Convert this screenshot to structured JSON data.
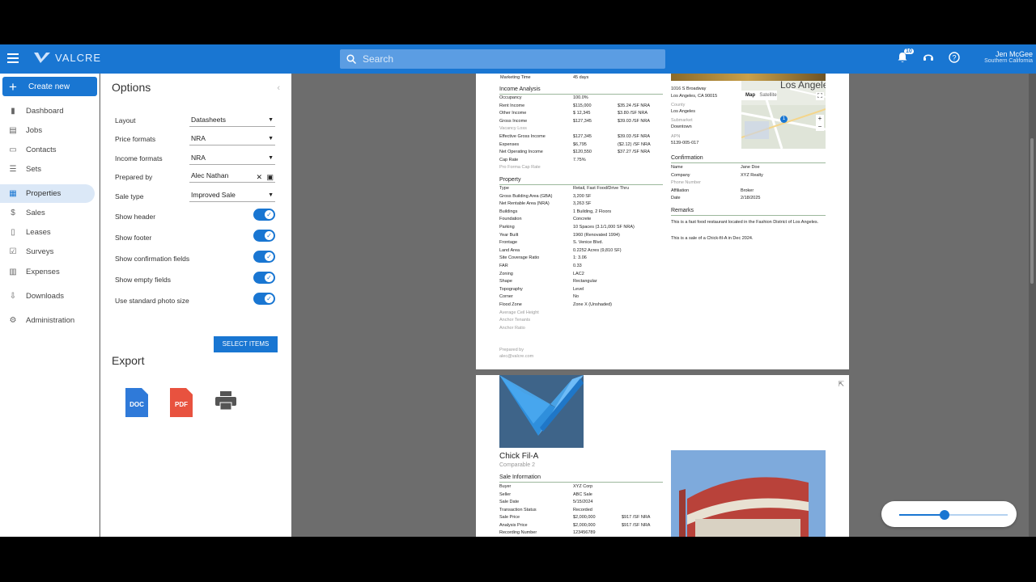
{
  "topbar": {
    "logo_text": "VALCRE",
    "search_placeholder": "Search",
    "notifications_count": "10",
    "user_name": "Jen McGee",
    "user_region": "Southern California"
  },
  "sidebar": {
    "create_label": "Create new",
    "items": [
      {
        "label": "Dashboard",
        "icon": "bar-chart-icon"
      },
      {
        "label": "Jobs",
        "icon": "clipboard-icon"
      },
      {
        "label": "Contacts",
        "icon": "contact-card-icon"
      },
      {
        "label": "Sets",
        "icon": "list-icon"
      },
      {
        "label": "Properties",
        "icon": "building-icon"
      },
      {
        "label": "Sales",
        "icon": "dollar-icon"
      },
      {
        "label": "Leases",
        "icon": "document-icon"
      },
      {
        "label": "Surveys",
        "icon": "checklist-icon"
      },
      {
        "label": "Expenses",
        "icon": "receipt-icon"
      },
      {
        "label": "Downloads",
        "icon": "download-icon"
      },
      {
        "label": "Administration",
        "icon": "gear-icon"
      }
    ]
  },
  "options": {
    "title": "Options",
    "layout_label": "Layout",
    "layout_value": "Datasheets",
    "price_label": "Price formats",
    "price_value": "NRA",
    "income_label": "Income formats",
    "income_value": "NRA",
    "prepared_label": "Prepared by",
    "prepared_value": "Alec Nathan",
    "saletype_label": "Sale type",
    "saletype_value": "Improved Sale",
    "toggles": [
      "Show header",
      "Show footer",
      "Show confirmation fields",
      "Show empty fields",
      "Use standard photo size"
    ],
    "select_items": "SELECT ITEMS",
    "export_title": "Export",
    "doc_label": "DOC",
    "pdf_label": "PDF"
  },
  "page1": {
    "marketing_label": "Marketing Time",
    "marketing_value": "45 days",
    "income_title": "Income Analysis",
    "income_rows": [
      [
        "Occupancy",
        "100.0%",
        ""
      ],
      [
        "Rent Income",
        "$115,000",
        "$35.24 /SF NRA"
      ],
      [
        "Other Income",
        "$ 12,345",
        "$3.80 /SF NRA"
      ],
      [
        "Gross Income",
        "$127,345",
        "$39.03 /SF NRA"
      ],
      [
        "Vacancy Loss",
        "",
        ""
      ],
      [
        "Effective Gross Income",
        "$127,345",
        "$39.03 /SF NRA"
      ],
      [
        "Expenses",
        "$6,795",
        "($2.12) /SF NRA"
      ],
      [
        "Net Operating Income",
        "$120,550",
        "$37.27 /SF NRA"
      ],
      [
        "Cap Rate",
        "7.75%",
        ""
      ],
      [
        "Pro Forma Cap Rate",
        "",
        ""
      ]
    ],
    "property_title": "Property",
    "property_rows": [
      [
        "Type",
        "Retail, Fast Food/Drive Thru"
      ],
      [
        "Gross Building Area (GBA)",
        "3,200 SF"
      ],
      [
        "Net Rentable Area (NRA)",
        "3,263 SF"
      ],
      [
        "Buildings",
        "1 Building, 2 Floors"
      ],
      [
        "Foundation",
        "Concrete"
      ],
      [
        "Parking",
        "10 Spaces (3.1/1,000 SF NRA)"
      ],
      [
        "Year Built",
        "1960 (Renovated 1994)"
      ],
      [
        "Frontage",
        "S. Venice Blvd."
      ],
      [
        "Land Area",
        "0.2252 Acres (9,810 SF)"
      ],
      [
        "Site Coverage Ratio",
        "1: 3.06"
      ],
      [
        "FAR",
        "0.33"
      ],
      [
        "Zoning",
        "LAC2"
      ],
      [
        "Shape",
        "Rectangular"
      ],
      [
        "Topography",
        "Level"
      ],
      [
        "Corner",
        "No"
      ],
      [
        "Flood Zone",
        "Zone X (Unshaded)"
      ],
      [
        "Average Ceil Height",
        ""
      ],
      [
        "Anchor Tenants",
        ""
      ],
      [
        "Anchor Ratio",
        ""
      ]
    ],
    "prepared_by_label": "Prepared by",
    "prepared_by_email": "alec@valcre.com",
    "address1": "1016 S Broadway",
    "address2": "Los Angeles, CA 90015",
    "county_label": "County",
    "county_value": "Los Angeles",
    "submarket_label": "Submarket",
    "submarket_value": "Downtown",
    "apn_label": "APN",
    "apn_value": "5139-005-017",
    "map_tab": "Map",
    "satellite_tab": "Satellite",
    "map_city": "Los Angeles",
    "confirmation_title": "Confirmation",
    "confirmation_rows": [
      [
        "Name",
        "Jane Doe"
      ],
      [
        "Company",
        "XYZ Realty"
      ],
      [
        "Phone Number",
        ""
      ],
      [
        "Affiliation",
        "Broker"
      ],
      [
        "Date",
        "2/18/2025"
      ]
    ],
    "remarks_title": "Remarks",
    "remarks_1": "This is a fast food restaurant located in the Fashion District of Los Angeles.",
    "remarks_2": "This is a sale of a Chick-fil-A in Dec 2024."
  },
  "page2": {
    "title": "Chick Fil-A",
    "subtitle": "Comparable 2",
    "sale_title": "Sale Information",
    "sale_rows": [
      [
        "Buyer",
        "XYZ Corp",
        ""
      ],
      [
        "Seller",
        "ABC Sale",
        ""
      ],
      [
        "Sale Date",
        "5/15/2024",
        ""
      ],
      [
        "Transaction Status",
        "Recorded",
        ""
      ],
      [
        "Sale Price",
        "$2,000,000",
        "$917 /SF NRA"
      ],
      [
        "Analysis Price",
        "$2,000,000",
        "$917 /SF NRA"
      ],
      [
        "Recording Number",
        "123456789",
        ""
      ]
    ]
  },
  "zoom": {
    "level": 0.42
  },
  "colors": {
    "primary": "#1976d2",
    "doc_blue": "#2f7ad9",
    "pdf_red": "#e8523f"
  }
}
